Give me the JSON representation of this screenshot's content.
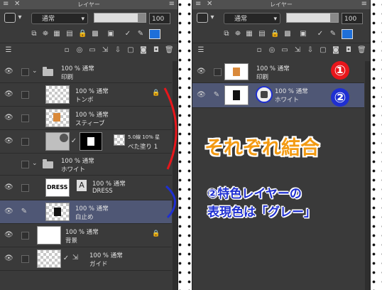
{
  "panels": [
    {
      "title": "レイヤー",
      "blend_mode": "通常",
      "opacity": "100",
      "layers": [
        {
          "pct": "100 % 通常",
          "name": "印刷"
        },
        {
          "pct": "100 % 通常",
          "name": "トンボ"
        },
        {
          "pct": "100 % 通常",
          "name": "スティーブ"
        },
        {
          "pct": "5.0線 10% 星",
          "name": "べた塗り 1"
        },
        {
          "pct": "100 % 通常",
          "name": "ホワイト"
        },
        {
          "pct": "100 % 通常",
          "name": "DRESS"
        },
        {
          "pct": "100 % 通常",
          "name": "白止め"
        },
        {
          "pct": "100 % 通常",
          "name": "背景"
        },
        {
          "pct": "100 % 通常",
          "name": "ガイド"
        }
      ],
      "thumb_text": "DRESS"
    },
    {
      "title": "レイヤー",
      "blend_mode": "通常",
      "opacity": "100",
      "layers": [
        {
          "pct": "100 % 通常",
          "name": "印刷"
        },
        {
          "pct": "100 % 通常",
          "name": "ホワイト"
        }
      ]
    }
  ],
  "annotations": {
    "badge1": "①",
    "badge2": "②",
    "headline": "それぞれ結合",
    "note_line1": "②特色レイヤーの",
    "note_line2": "表現色は「グレー」"
  },
  "colors": {
    "panel_bg": "#3a3a3a",
    "selected_row": "#4f5775",
    "headline_orange": "#f39a12",
    "note_blue": "#1f2fd1",
    "red": "#e8161b"
  }
}
